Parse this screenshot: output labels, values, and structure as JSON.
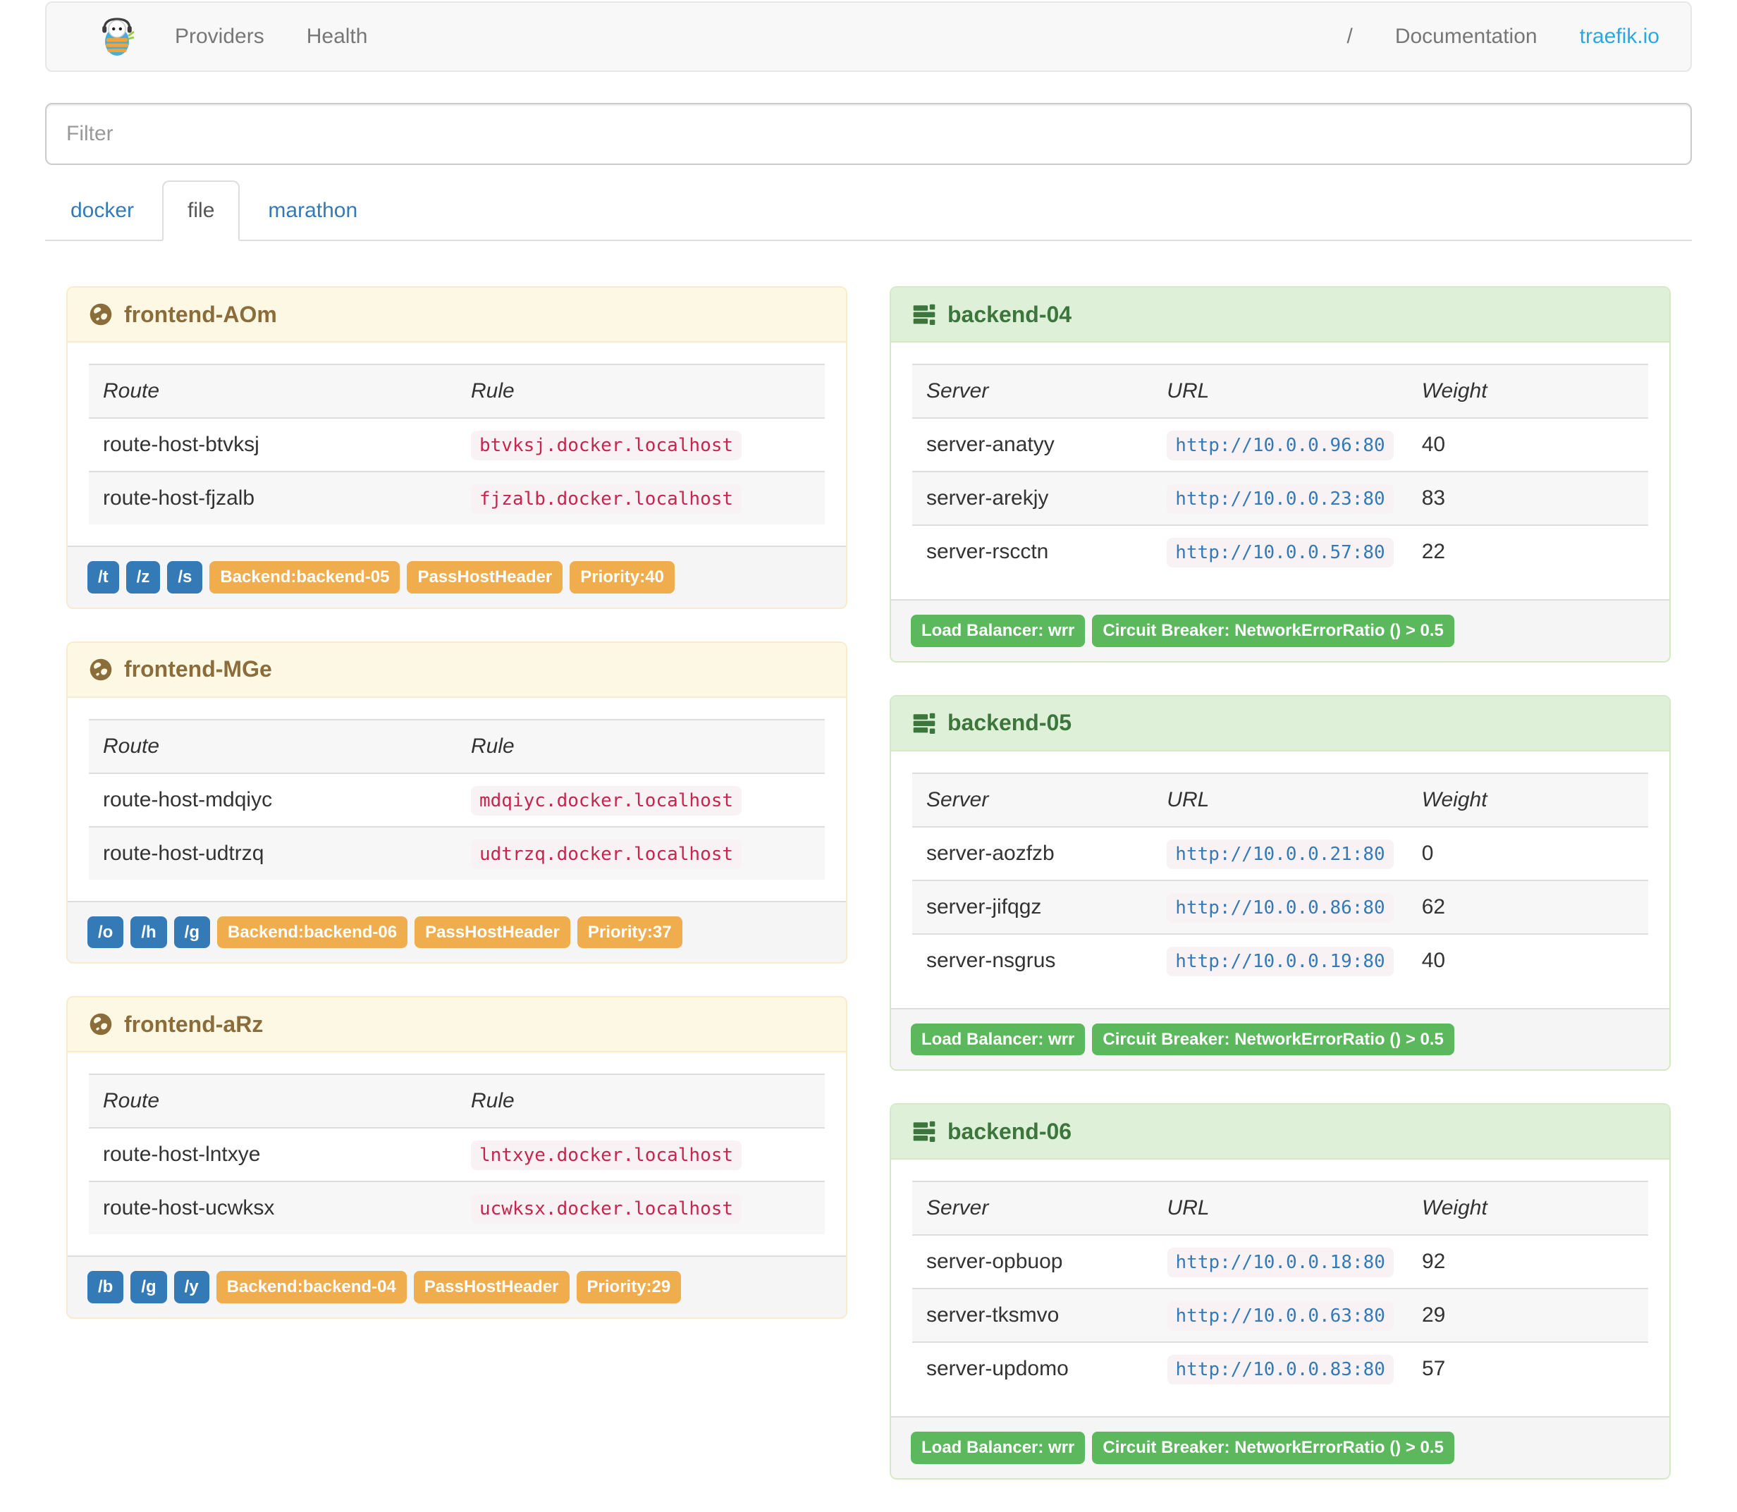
{
  "navbar": {
    "providers_label": "Providers",
    "health_label": "Health",
    "separator": "/",
    "documentation_label": "Documentation",
    "site_label": "traefik.io"
  },
  "filter": {
    "placeholder": "Filter"
  },
  "tabs": [
    {
      "label": "docker",
      "active": false
    },
    {
      "label": "file",
      "active": true
    },
    {
      "label": "marathon",
      "active": false
    }
  ],
  "table_headers": {
    "frontend": [
      "Route",
      "Rule"
    ],
    "backend": [
      "Server",
      "URL",
      "Weight"
    ]
  },
  "frontends": [
    {
      "title": "frontend-AOm",
      "routes": [
        {
          "route": "route-host-btvksj",
          "rule": "btvksj.docker.localhost"
        },
        {
          "route": "route-host-fjzalb",
          "rule": "fjzalb.docker.localhost"
        }
      ],
      "entry_points": [
        "/t",
        "/z",
        "/s"
      ],
      "settings": [
        "Backend:backend-05",
        "PassHostHeader",
        "Priority:40"
      ]
    },
    {
      "title": "frontend-MGe",
      "routes": [
        {
          "route": "route-host-mdqiyc",
          "rule": "mdqiyc.docker.localhost"
        },
        {
          "route": "route-host-udtrzq",
          "rule": "udtrzq.docker.localhost"
        }
      ],
      "entry_points": [
        "/o",
        "/h",
        "/g"
      ],
      "settings": [
        "Backend:backend-06",
        "PassHostHeader",
        "Priority:37"
      ]
    },
    {
      "title": "frontend-aRz",
      "routes": [
        {
          "route": "route-host-lntxye",
          "rule": "lntxye.docker.localhost"
        },
        {
          "route": "route-host-ucwksx",
          "rule": "ucwksx.docker.localhost"
        }
      ],
      "entry_points": [
        "/b",
        "/g",
        "/y"
      ],
      "settings": [
        "Backend:backend-04",
        "PassHostHeader",
        "Priority:29"
      ]
    }
  ],
  "backends": [
    {
      "title": "backend-04",
      "servers": [
        {
          "server": "server-anatyy",
          "url": "http://10.0.0.96:80",
          "weight": "40"
        },
        {
          "server": "server-arekjy",
          "url": "http://10.0.0.23:80",
          "weight": "83"
        },
        {
          "server": "server-rscctn",
          "url": "http://10.0.0.57:80",
          "weight": "22"
        }
      ],
      "badges": [
        "Load Balancer: wrr",
        "Circuit Breaker: NetworkErrorRatio () > 0.5"
      ]
    },
    {
      "title": "backend-05",
      "servers": [
        {
          "server": "server-aozfzb",
          "url": "http://10.0.0.21:80",
          "weight": "0"
        },
        {
          "server": "server-jifqgz",
          "url": "http://10.0.0.86:80",
          "weight": "62"
        },
        {
          "server": "server-nsgrus",
          "url": "http://10.0.0.19:80",
          "weight": "40"
        }
      ],
      "badges": [
        "Load Balancer: wrr",
        "Circuit Breaker: NetworkErrorRatio () > 0.5"
      ]
    },
    {
      "title": "backend-06",
      "servers": [
        {
          "server": "server-opbuop",
          "url": "http://10.0.0.18:80",
          "weight": "92"
        },
        {
          "server": "server-tksmvo",
          "url": "http://10.0.0.63:80",
          "weight": "29"
        },
        {
          "server": "server-updomo",
          "url": "http://10.0.0.83:80",
          "weight": "57"
        }
      ],
      "badges": [
        "Load Balancer: wrr",
        "Circuit Breaker: NetworkErrorRatio () > 0.5"
      ]
    }
  ],
  "colors": {
    "site_link": "#29a9e2",
    "tab_link": "#337ab7",
    "frontend_header_bg": "#fcf8e3",
    "frontend_header_text": "#8a6d3b",
    "backend_header_bg": "#dff0d8",
    "backend_header_text": "#3c763d",
    "code_rule_text": "#c7254e",
    "code_url_text": "#337ab7",
    "code_bg": "#f9f2f4",
    "badge_primary": "#337ab7",
    "badge_warning": "#f0ad4e",
    "badge_success": "#5cb85c"
  }
}
